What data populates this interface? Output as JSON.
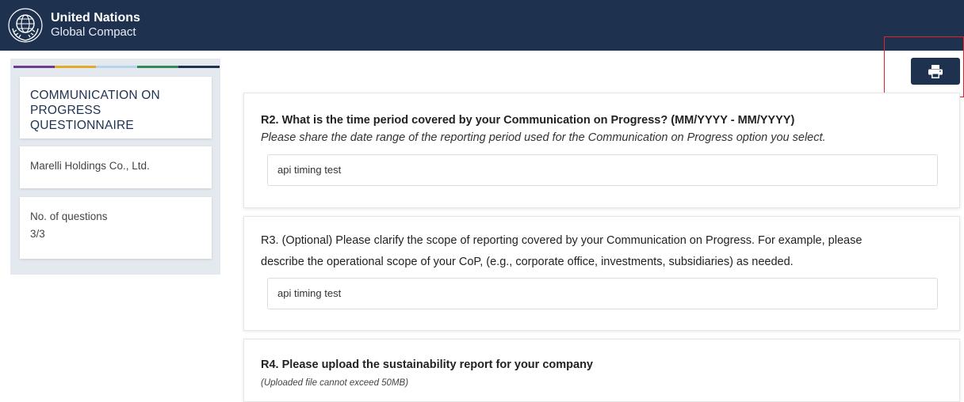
{
  "header": {
    "brand_line1": "United Nations",
    "brand_line2": "Global Compact",
    "background": "#1e3250"
  },
  "sidebar": {
    "stripe_colors": [
      "#6a3d8f",
      "#e2a92b",
      "#b8d3ea",
      "#2e8b57",
      "#1e3250"
    ],
    "title": "COMMUNICATION ON PROGRESS QUESTIONNAIRE",
    "company": "Marelli Holdings Co., Ltd.",
    "questions_label": "No. of questions",
    "questions_value": "3/3"
  },
  "toolbar": {
    "print_icon": "printer-icon"
  },
  "questions": [
    {
      "title": "R2. What is the time period covered by your Communication on Progress? (MM/YYYY - MM/YYYY)",
      "subtitle": "Please share the date range of the reporting period used for the Communication on Progress option you select.",
      "answer": "api timing test"
    },
    {
      "title_line1": "R3. (Optional) Please clarify the scope of reporting covered by your Communication on Progress. For example, please",
      "title_line2": "describe the operational scope of your CoP, (e.g., corporate office, investments, subsidiaries) as needed.",
      "answer": "api timing test"
    },
    {
      "title": "R4. Please upload the sustainability report for your company",
      "note": "(Uploaded file cannot exceed 50MB)"
    }
  ]
}
